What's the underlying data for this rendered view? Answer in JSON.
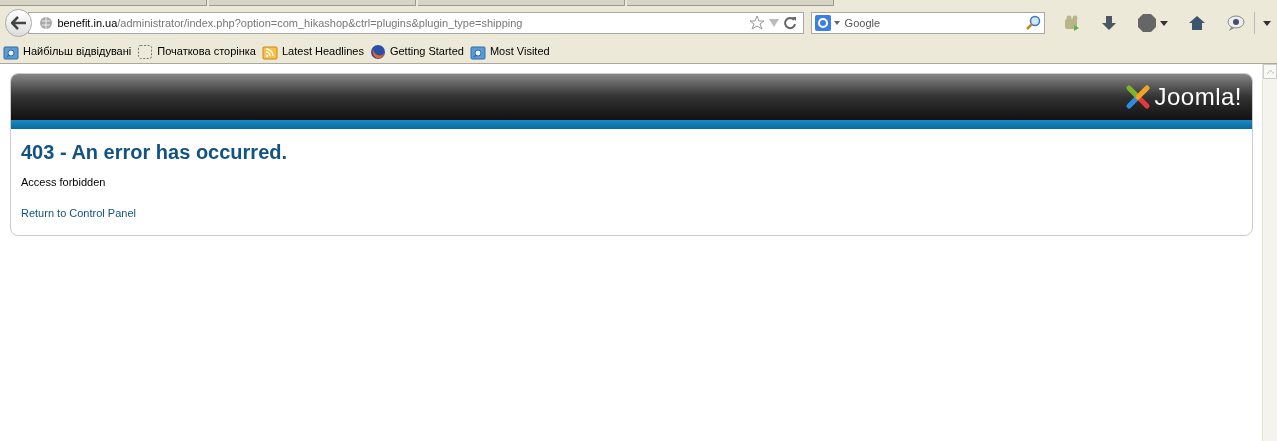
{
  "address_bar": {
    "domain": "benefit.in.ua",
    "path": "/administrator/index.php?option=com_hikashop&ctrl=plugins&plugin_type=shipping"
  },
  "search": {
    "engine_placeholder": "Google"
  },
  "bookmarks": [
    {
      "label": "Найбільш відвідувані",
      "kind": "folder"
    },
    {
      "label": "Початкова сторінка",
      "kind": "blank"
    },
    {
      "label": "Latest Headlines",
      "kind": "feed"
    },
    {
      "label": "Getting Started",
      "kind": "firefox"
    },
    {
      "label": "Most Visited",
      "kind": "folder"
    }
  ],
  "page": {
    "logo": "Joomla!",
    "heading": "403 - An error has occurred.",
    "message": "Access forbidden",
    "link": "Return to Control Panel"
  }
}
